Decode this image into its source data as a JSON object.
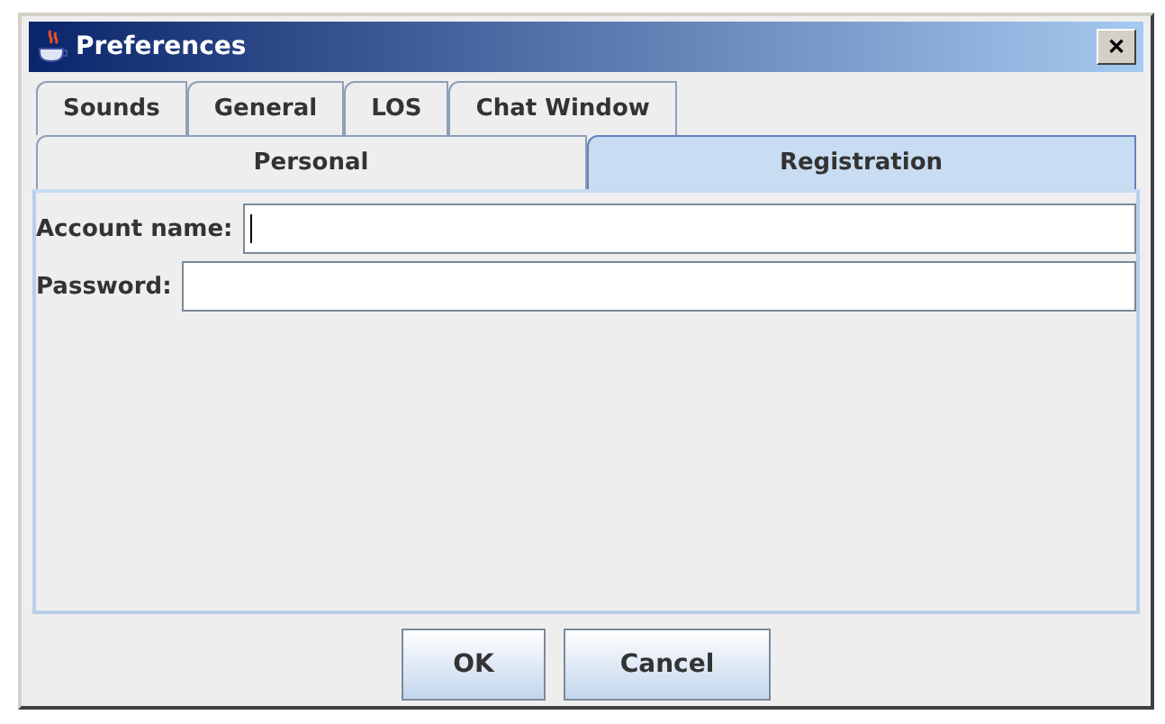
{
  "window": {
    "title": "Preferences",
    "close": "✕"
  },
  "tab_rows": [
    [
      {
        "label": "Sounds",
        "selected": false
      },
      {
        "label": "General",
        "selected": false
      },
      {
        "label": "LOS",
        "selected": false
      },
      {
        "label": "Chat Window",
        "selected": false
      }
    ],
    [
      {
        "label": "Personal",
        "selected": false
      },
      {
        "label": "Registration",
        "selected": true
      }
    ]
  ],
  "fields": [
    {
      "label": "Account name:",
      "focused": true
    },
    {
      "label": "Password:",
      "focused": false
    }
  ],
  "buttons": [
    "OK",
    "Cancel"
  ]
}
